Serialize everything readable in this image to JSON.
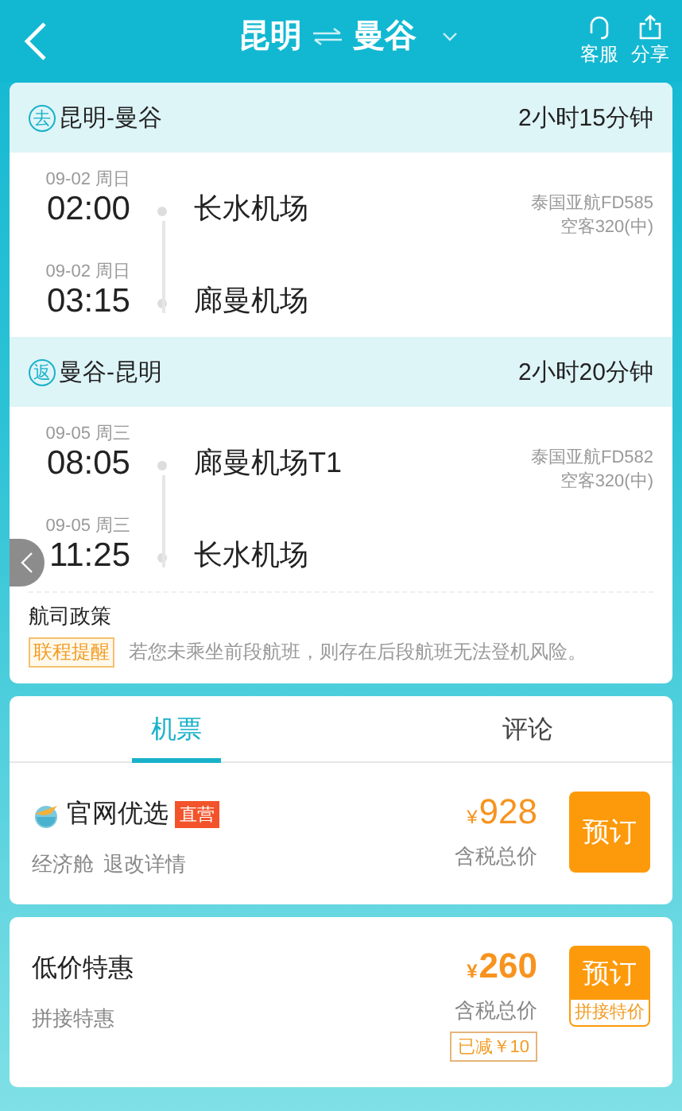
{
  "header": {
    "from": "昆明",
    "to": "曼谷",
    "actions": [
      {
        "kind": "service",
        "label": "客服"
      },
      {
        "kind": "share",
        "label": "分享"
      }
    ]
  },
  "segments": [
    {
      "badge": "去",
      "route": "昆明-曼谷",
      "duration": "2小时15分钟",
      "airline": "泰国亚航FD585",
      "aircraft": "空客320(中)",
      "legs": [
        {
          "date": "09-02 周日",
          "time": "02:00",
          "airport": "长水机场"
        },
        {
          "date": "09-02 周日",
          "time": "03:15",
          "airport": "廊曼机场"
        }
      ]
    },
    {
      "badge": "返",
      "route": "曼谷-昆明",
      "duration": "2小时20分钟",
      "airline": "泰国亚航FD582",
      "aircraft": "空客320(中)",
      "legs": [
        {
          "date": "09-05 周三",
          "time": "08:05",
          "airport": "廊曼机场T1"
        },
        {
          "date": "09-05 周三",
          "time": "11:25",
          "airport": "长水机场"
        }
      ]
    }
  ],
  "policy": {
    "title": "航司政策",
    "tag": "联程提醒",
    "text": "若您未乘坐前段航班，则存在后段航班无法登机风险。"
  },
  "tabs": [
    {
      "label": "机票",
      "selected": true
    },
    {
      "label": "评论",
      "selected": false
    }
  ],
  "offers": [
    {
      "kind": "official",
      "name": "官网优选",
      "tag": "直营",
      "details": [
        "经济舱",
        "退改详情"
      ],
      "currency": "¥",
      "price": "928",
      "price_note": "含税总价",
      "button": "预订"
    },
    {
      "kind": "plain",
      "name": "低价特惠",
      "details": [
        "拼接特惠"
      ],
      "currency": "¥",
      "price": "260",
      "price_note": "含税总价",
      "discount": "已减￥10",
      "button": "预订",
      "button_sub": "拼接特价"
    }
  ]
}
